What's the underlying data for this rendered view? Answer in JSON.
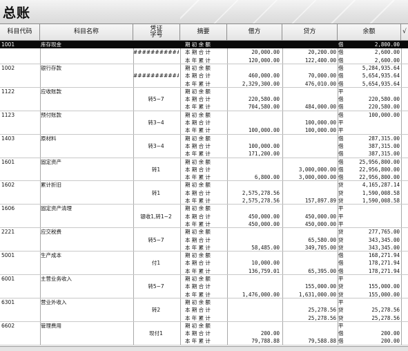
{
  "window": {
    "title": "总账"
  },
  "columns": {
    "code": "科目代码",
    "name": "科目名称",
    "voucher_top": "凭证",
    "voucher_bottom": "字号",
    "summary": "摘要",
    "debit": "借方",
    "credit": "贷方",
    "balance": "余额",
    "check": "√"
  },
  "rows": [
    {
      "code": "1001",
      "name": "库存现金",
      "voucher": "",
      "summary": "期初余额",
      "debit": "",
      "credit": "",
      "dir": "借",
      "balance": "2,800.00"
    },
    {
      "code": "",
      "name": "",
      "voucher": "##############",
      "summary": "本期合计",
      "debit": "20,000.00",
      "credit": "20,200.00",
      "dir": "借",
      "balance": "2,600.00"
    },
    {
      "code": "",
      "name": "",
      "voucher": "",
      "summary": "本年累计",
      "debit": "120,000.00",
      "credit": "122,400.00",
      "dir": "借",
      "balance": "2,600.00"
    },
    {
      "code": "1002",
      "name": "银行存款",
      "voucher": "",
      "summary": "期初余额",
      "debit": "",
      "credit": "",
      "dir": "借",
      "balance": "5,284,935.64"
    },
    {
      "code": "",
      "name": "",
      "voucher": "############",
      "summary": "本期合计",
      "debit": "460,000.00",
      "credit": "70,000.00",
      "dir": "借",
      "balance": "5,654,935.64"
    },
    {
      "code": "",
      "name": "",
      "voucher": "",
      "summary": "本年累计",
      "debit": "2,329,300.00",
      "credit": "476,010.00",
      "dir": "借",
      "balance": "5,654,935.64"
    },
    {
      "code": "1122",
      "name": "应收账款",
      "voucher": "",
      "summary": "期初余额",
      "debit": "",
      "credit": "",
      "dir": "平",
      "balance": ""
    },
    {
      "code": "",
      "name": "",
      "voucher": "转5~7",
      "summary": "本期合计",
      "debit": "220,580.00",
      "credit": "",
      "dir": "借",
      "balance": "220,580.00"
    },
    {
      "code": "",
      "name": "",
      "voucher": "",
      "summary": "本年累计",
      "debit": "704,580.00",
      "credit": "484,000.00",
      "dir": "借",
      "balance": "220,580.00"
    },
    {
      "code": "1123",
      "name": "预付账款",
      "voucher": "",
      "summary": "期初余额",
      "debit": "",
      "credit": "",
      "dir": "借",
      "balance": "100,000.00"
    },
    {
      "code": "",
      "name": "",
      "voucher": "转3~4",
      "summary": "本期合计",
      "debit": "",
      "credit": "100,000.00",
      "dir": "平",
      "balance": ""
    },
    {
      "code": "",
      "name": "",
      "voucher": "",
      "summary": "本年累计",
      "debit": "100,000.00",
      "credit": "100,000.00",
      "dir": "平",
      "balance": ""
    },
    {
      "code": "1403",
      "name": "原材料",
      "voucher": "",
      "summary": "期初余额",
      "debit": "",
      "credit": "",
      "dir": "借",
      "balance": "287,315.00"
    },
    {
      "code": "",
      "name": "",
      "voucher": "转3~4",
      "summary": "本期合计",
      "debit": "100,000.00",
      "credit": "",
      "dir": "借",
      "balance": "387,315.00"
    },
    {
      "code": "",
      "name": "",
      "voucher": "",
      "summary": "本年累计",
      "debit": "171,200.00",
      "credit": "",
      "dir": "借",
      "balance": "387,315.00"
    },
    {
      "code": "1601",
      "name": "固定资产",
      "voucher": "",
      "summary": "期初余额",
      "debit": "",
      "credit": "",
      "dir": "借",
      "balance": "25,956,800.00"
    },
    {
      "code": "",
      "name": "",
      "voucher": "转1",
      "summary": "本期合计",
      "debit": "",
      "credit": "3,000,000.00",
      "dir": "借",
      "balance": "22,956,800.00"
    },
    {
      "code": "",
      "name": "",
      "voucher": "",
      "summary": "本年累计",
      "debit": "6,800.00",
      "credit": "3,000,000.00",
      "dir": "借",
      "balance": "22,956,800.00"
    },
    {
      "code": "1602",
      "name": "累计折旧",
      "voucher": "",
      "summary": "期初余额",
      "debit": "",
      "credit": "",
      "dir": "贷",
      "balance": "4,165,287.14"
    },
    {
      "code": "",
      "name": "",
      "voucher": "转1",
      "summary": "本期合计",
      "debit": "2,575,278.56",
      "credit": "",
      "dir": "贷",
      "balance": "1,590,008.58"
    },
    {
      "code": "",
      "name": "",
      "voucher": "",
      "summary": "本年累计",
      "debit": "2,575,278.56",
      "credit": "157,897.89",
      "dir": "贷",
      "balance": "1,590,008.58"
    },
    {
      "code": "1606",
      "name": "固定资产清理",
      "voucher": "",
      "summary": "期初余额",
      "debit": "",
      "credit": "",
      "dir": "平",
      "balance": ""
    },
    {
      "code": "",
      "name": "",
      "voucher": "银收1,转1~2",
      "summary": "本期合计",
      "debit": "450,000.00",
      "credit": "450,000.00",
      "dir": "平",
      "balance": ""
    },
    {
      "code": "",
      "name": "",
      "voucher": "",
      "summary": "本年累计",
      "debit": "450,000.00",
      "credit": "450,000.00",
      "dir": "平",
      "balance": ""
    },
    {
      "code": "2221",
      "name": "应交税费",
      "voucher": "",
      "summary": "期初余额",
      "debit": "",
      "credit": "",
      "dir": "贷",
      "balance": "277,765.00"
    },
    {
      "code": "",
      "name": "",
      "voucher": "转5~7",
      "summary": "本期合计",
      "debit": "",
      "credit": "65,580.00",
      "dir": "贷",
      "balance": "343,345.00"
    },
    {
      "code": "",
      "name": "",
      "voucher": "",
      "summary": "本年累计",
      "debit": "58,485.00",
      "credit": "349,705.00",
      "dir": "贷",
      "balance": "343,345.00"
    },
    {
      "code": "5001",
      "name": "生产成本",
      "voucher": "",
      "summary": "期初余额",
      "debit": "",
      "credit": "",
      "dir": "借",
      "balance": "168,271.94"
    },
    {
      "code": "",
      "name": "",
      "voucher": "付1",
      "summary": "本期合计",
      "debit": "10,000.00",
      "credit": "",
      "dir": "借",
      "balance": "178,271.94"
    },
    {
      "code": "",
      "name": "",
      "voucher": "",
      "summary": "本年累计",
      "debit": "136,759.01",
      "credit": "65,395.00",
      "dir": "借",
      "balance": "178,271.94"
    },
    {
      "code": "6001",
      "name": "主营业务收入",
      "voucher": "",
      "summary": "期初余额",
      "debit": "",
      "credit": "",
      "dir": "平",
      "balance": ""
    },
    {
      "code": "",
      "name": "",
      "voucher": "转5~7",
      "summary": "本期合计",
      "debit": "",
      "credit": "155,000.00",
      "dir": "贷",
      "balance": "155,000.00"
    },
    {
      "code": "",
      "name": "",
      "voucher": "",
      "summary": "本年累计",
      "debit": "1,476,000.00",
      "credit": "1,631,000.00",
      "dir": "贷",
      "balance": "155,000.00"
    },
    {
      "code": "6301",
      "name": "营业外收入",
      "voucher": "",
      "summary": "期初余额",
      "debit": "",
      "credit": "",
      "dir": "平",
      "balance": ""
    },
    {
      "code": "",
      "name": "",
      "voucher": "转2",
      "summary": "本期合计",
      "debit": "",
      "credit": "25,278.56",
      "dir": "贷",
      "balance": "25,278.56"
    },
    {
      "code": "",
      "name": "",
      "voucher": "",
      "summary": "本年累计",
      "debit": "",
      "credit": "25,278.56",
      "dir": "贷",
      "balance": "25,278.56"
    },
    {
      "code": "6602",
      "name": "管理费用",
      "voucher": "",
      "summary": "期初余额",
      "debit": "",
      "credit": "",
      "dir": "平",
      "balance": ""
    },
    {
      "code": "",
      "name": "",
      "voucher": "现付1",
      "summary": "本期合计",
      "debit": "200.00",
      "credit": "",
      "dir": "借",
      "balance": "200.00"
    },
    {
      "code": "",
      "name": "",
      "voucher": "",
      "summary": "本年累计",
      "debit": "79,788.88",
      "credit": "79,588.88",
      "dir": "借",
      "balance": "200.00"
    }
  ],
  "selected_row_index": 0
}
